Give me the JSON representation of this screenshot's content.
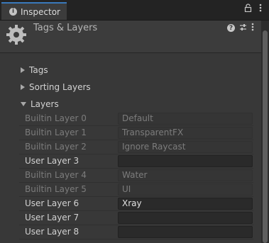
{
  "tab": {
    "label": "Inspector",
    "icon": "info-icon"
  },
  "header": {
    "title": "Tags & Layers",
    "icon": "gear-icon"
  },
  "sections": {
    "tags": "Tags",
    "sorting_layers": "Sorting Layers",
    "layers": "Layers"
  },
  "layers": [
    {
      "label": "Builtin Layer 0",
      "value": "Default",
      "editable": false
    },
    {
      "label": "Builtin Layer 1",
      "value": "TransparentFX",
      "editable": false
    },
    {
      "label": "Builtin Layer 2",
      "value": "Ignore Raycast",
      "editable": false
    },
    {
      "label": "User Layer 3",
      "value": "",
      "editable": true
    },
    {
      "label": "Builtin Layer 4",
      "value": "Water",
      "editable": false
    },
    {
      "label": "Builtin Layer 5",
      "value": "UI",
      "editable": false
    },
    {
      "label": "User Layer 6",
      "value": "Xray",
      "editable": true
    },
    {
      "label": "User Layer 7",
      "value": "",
      "editable": true
    },
    {
      "label": "User Layer 8",
      "value": "",
      "editable": true
    }
  ]
}
